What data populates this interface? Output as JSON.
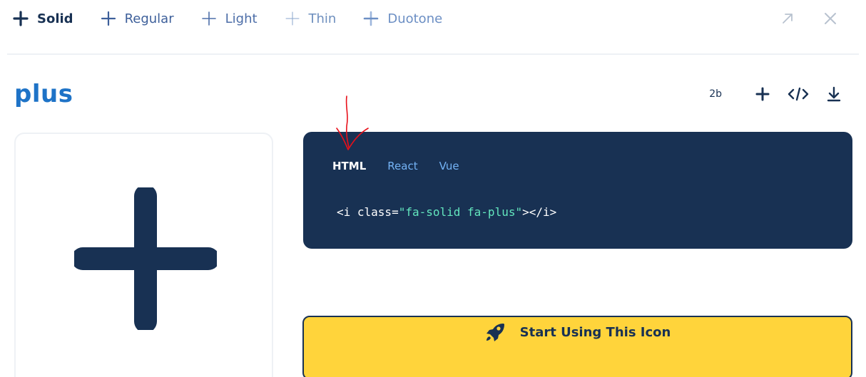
{
  "style_tabs": [
    {
      "label": "Solid",
      "active": true
    },
    {
      "label": "Regular",
      "active": false
    },
    {
      "label": "Light",
      "active": false
    },
    {
      "label": "Thin",
      "active": false
    },
    {
      "label": "Duotone",
      "active": false
    }
  ],
  "top_actions": {
    "expand_icon": "arrow-up-right-icon",
    "close_icon": "close-icon"
  },
  "icon": {
    "name": "plus",
    "unicode": "2b"
  },
  "title_actions": {
    "add_icon": "plus-icon",
    "code_icon": "code-icon",
    "download_icon": "download-icon"
  },
  "code": {
    "tabs": [
      {
        "label": "HTML",
        "active": true
      },
      {
        "label": "React",
        "active": false
      },
      {
        "label": "Vue",
        "active": false
      }
    ],
    "prefix": "<i class=",
    "class_string": "\"fa-solid fa-plus\"",
    "suffix": "></i>"
  },
  "cta": {
    "label": "Start Using This Icon",
    "icon": "rocket-icon"
  },
  "colors": {
    "navy": "#183153",
    "title_blue": "#1e73c7",
    "yellow": "#ffd43b",
    "code_string": "#63e6be",
    "annotation_red": "#e8101a"
  }
}
